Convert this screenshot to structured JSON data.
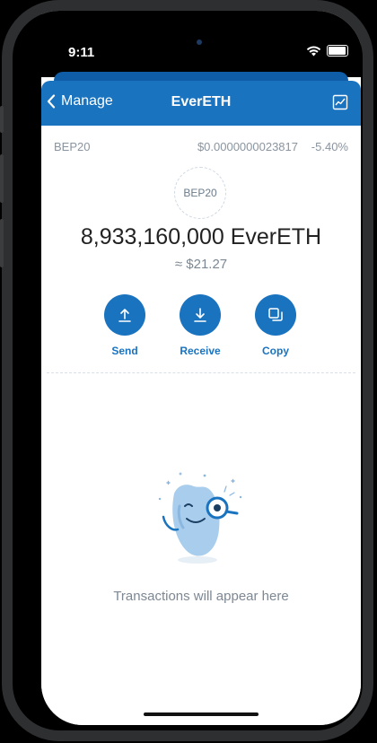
{
  "status_bar": {
    "time": "9:11"
  },
  "navbar": {
    "back_label": "Manage",
    "title": "EverETH"
  },
  "token": {
    "network": "BEP20",
    "price": "$0.0000000023817",
    "change": "-5.40%",
    "logo_text": "BEP20",
    "balance": "8,933,160,000 EverETH",
    "fiat_value": "≈ $21.27"
  },
  "actions": [
    {
      "label": "Send",
      "icon": "arrow-up-icon"
    },
    {
      "label": "Receive",
      "icon": "arrow-down-icon"
    },
    {
      "label": "Copy",
      "icon": "copy-icon"
    }
  ],
  "transactions": {
    "empty_text": "Transactions will appear here"
  },
  "colors": {
    "accent": "#1a73bf",
    "muted_text": "#7d8893",
    "negative": "#8a949f"
  }
}
